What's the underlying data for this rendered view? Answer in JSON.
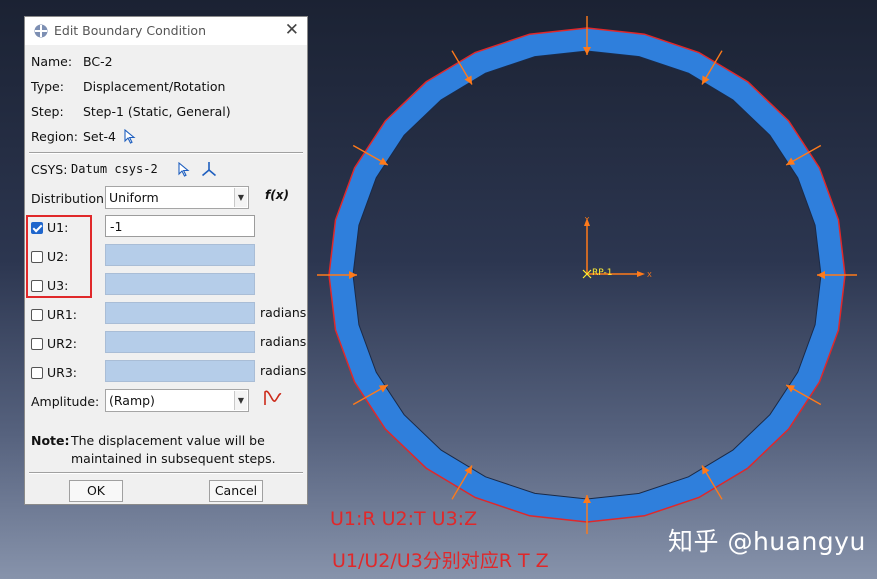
{
  "dialog": {
    "title": "Edit Boundary Condition",
    "name_label": "Name:",
    "name_value": "BC-2",
    "type_label": "Type:",
    "type_value": "Displacement/Rotation",
    "step_label": "Step:",
    "step_value": "Step-1 (Static, General)",
    "region_label": "Region:",
    "region_value": "Set-4",
    "csys_label": "CSYS:",
    "csys_value": "Datum csys-2",
    "distribution_label": "Distribution:",
    "distribution_value": "Uniform",
    "fx_label": "f(x)",
    "dofs": [
      {
        "label": "U1:",
        "checked": true,
        "value": "-1"
      },
      {
        "label": "U2:",
        "checked": false,
        "value": ""
      },
      {
        "label": "U3:",
        "checked": false,
        "value": ""
      },
      {
        "label": "UR1:",
        "checked": false,
        "value": "",
        "unit": "radians"
      },
      {
        "label": "UR2:",
        "checked": false,
        "value": "",
        "unit": "radians"
      },
      {
        "label": "UR3:",
        "checked": false,
        "value": "",
        "unit": "radians"
      }
    ],
    "amplitude_label": "Amplitude:",
    "amplitude_value": "(Ramp)",
    "note_label": "Note:",
    "note_line1": "The displacement value will be",
    "note_line2": "maintained in subsequent steps.",
    "ok_label": "OK",
    "cancel_label": "Cancel"
  },
  "viewport": {
    "rp_label": "RP-1",
    "axis_y": "Y",
    "axis_x": "X",
    "annotation_line1": "U1:R U2:T U3:Z",
    "annotation_line2": "U1/U2/U3分别对应R T Z",
    "watermark": "知乎 @huangyu"
  },
  "colors": {
    "ring_fill": "#2f7fdc",
    "ring_outline": "#e0282a",
    "arrow": "#ff7a1a",
    "annotation": "#e0282a",
    "accent_check": "#1f66cc"
  }
}
